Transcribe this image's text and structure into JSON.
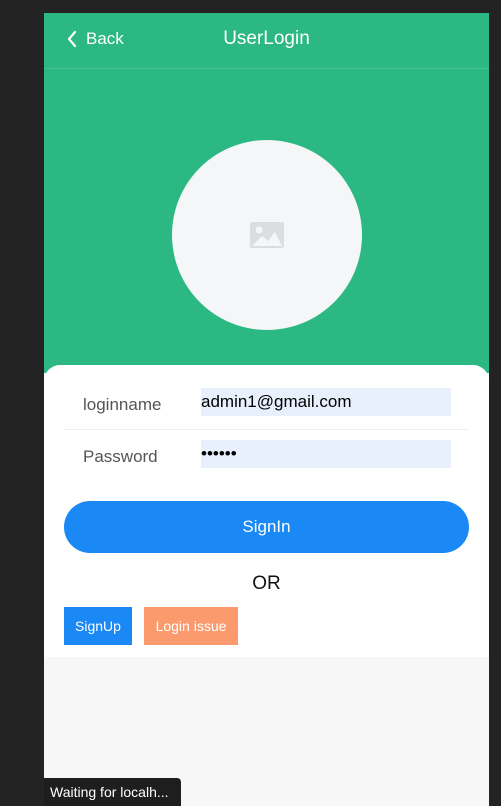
{
  "navbar": {
    "back_label": "Back",
    "title": "UserLogin",
    "back_icon": "chevron-left-icon"
  },
  "avatar": {
    "icon": "image-placeholder-icon"
  },
  "form": {
    "loginname_label": "loginname",
    "loginname_value": "admin1@gmail.com",
    "password_label": "Password",
    "password_value": "••••••"
  },
  "actions": {
    "signin_label": "SignIn",
    "or_text": "OR",
    "signup_label": "SignUp",
    "login_issue_label": "Login issue"
  },
  "status": {
    "text": "Waiting for localh..."
  },
  "colors": {
    "header": "#2bb883",
    "primary": "#1a89f5",
    "issue": "#fb9a6d",
    "input_bg": "#e8f0fe"
  }
}
